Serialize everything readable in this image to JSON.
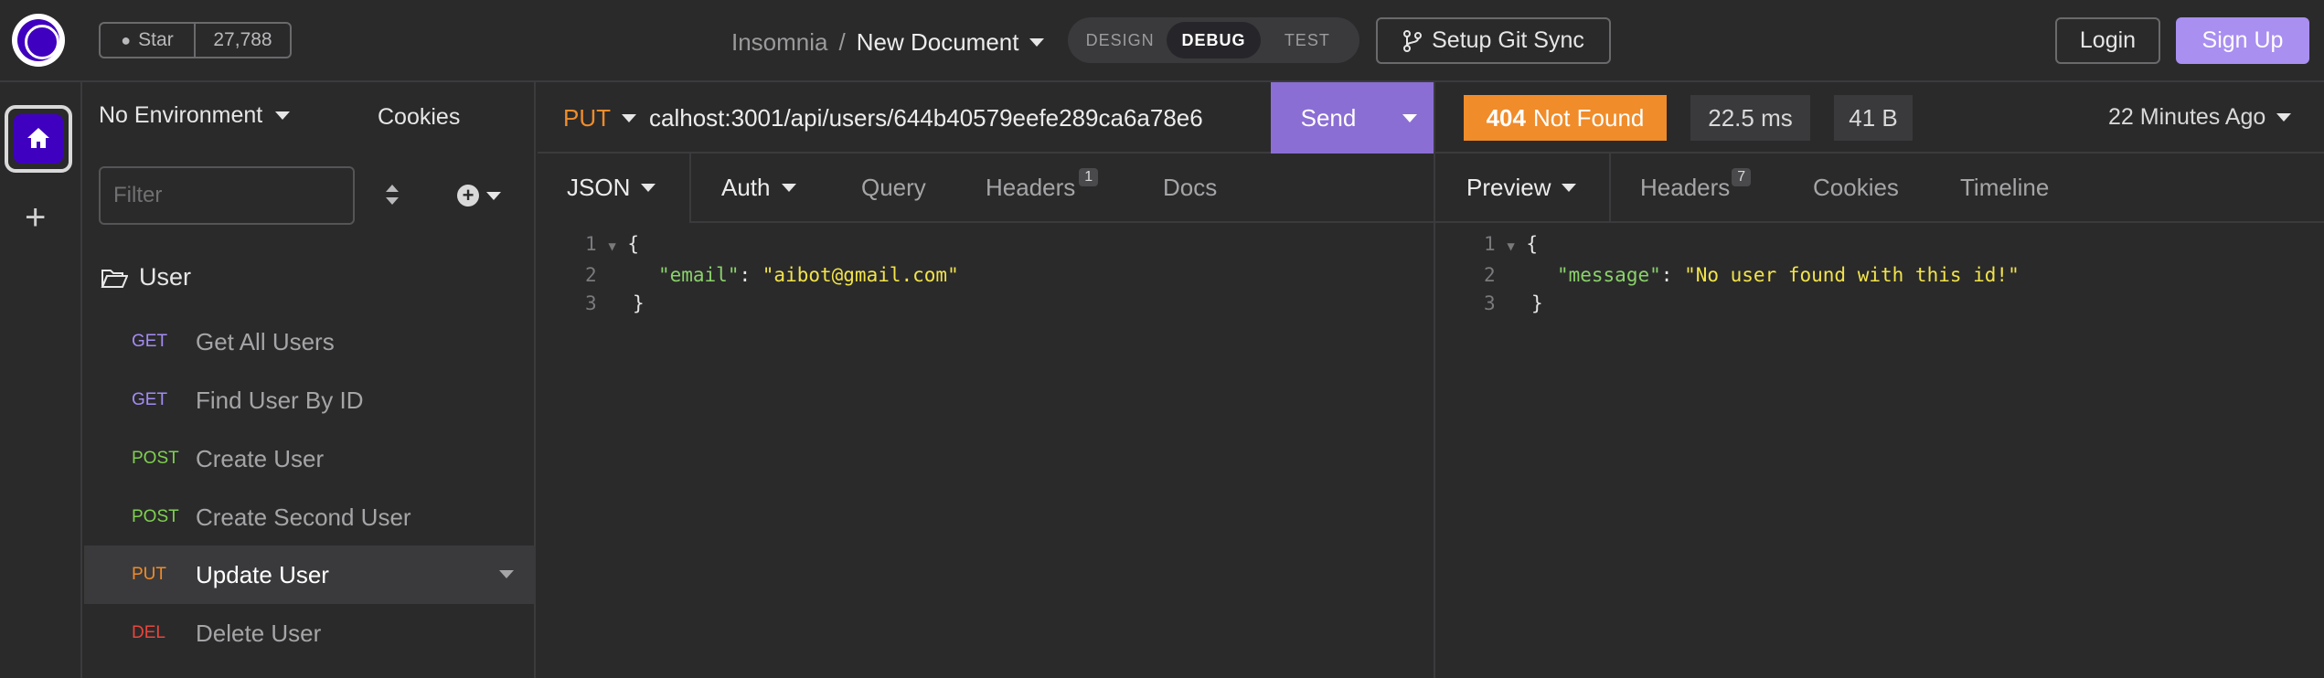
{
  "header": {
    "github": {
      "star_label": "Star",
      "star_count": "27,788"
    },
    "breadcrumb": {
      "workspace": "Insomnia",
      "separator": "/",
      "document": "New Document"
    },
    "modes": [
      "DESIGN",
      "DEBUG",
      "TEST"
    ],
    "active_mode": "DEBUG",
    "git_sync_label": "Setup Git Sync",
    "login_label": "Login",
    "signup_label": "Sign Up"
  },
  "sidebar": {
    "environment": "No Environment",
    "cookies_label": "Cookies",
    "filter_placeholder": "Filter",
    "folder": "User",
    "requests": [
      {
        "method": "GET",
        "name": "Get All Users",
        "color": "#a48cf2"
      },
      {
        "method": "GET",
        "name": "Find User By ID",
        "color": "#a48cf2"
      },
      {
        "method": "POST",
        "name": "Create User",
        "color": "#7fd14e"
      },
      {
        "method": "POST",
        "name": "Create Second User",
        "color": "#7fd14e"
      },
      {
        "method": "PUT",
        "name": "Update User",
        "color": "#f08c2a",
        "active": true
      },
      {
        "method": "DEL",
        "name": "Delete User",
        "color": "#e8453c"
      }
    ]
  },
  "request": {
    "method": "PUT",
    "url": "calhost:3001/api/users/644b40579eefe289ca6a78e6",
    "send_label": "Send",
    "tabs": {
      "body": "JSON",
      "auth": "Auth",
      "query": "Query",
      "headers": "Headers",
      "headers_count": "1",
      "docs": "Docs"
    },
    "body_lines": [
      {
        "n": "1",
        "open": "{"
      },
      {
        "n": "2",
        "key": "\"email\"",
        "colon": ": ",
        "value": "\"aibot@gmail.com\""
      },
      {
        "n": "3",
        "close": "}"
      }
    ]
  },
  "response": {
    "status_code": "404",
    "status_text": "Not Found",
    "time": "22.5 ms",
    "size": "41 B",
    "age": "22 Minutes Ago",
    "tabs": {
      "preview": "Preview",
      "headers": "Headers",
      "headers_count": "7",
      "cookies": "Cookies",
      "timeline": "Timeline"
    },
    "body_lines": [
      {
        "n": "1",
        "open": "{"
      },
      {
        "n": "2",
        "key": "\"message\"",
        "colon": ": ",
        "value": "\"No user found with this id!\""
      },
      {
        "n": "3",
        "close": "}"
      }
    ]
  }
}
